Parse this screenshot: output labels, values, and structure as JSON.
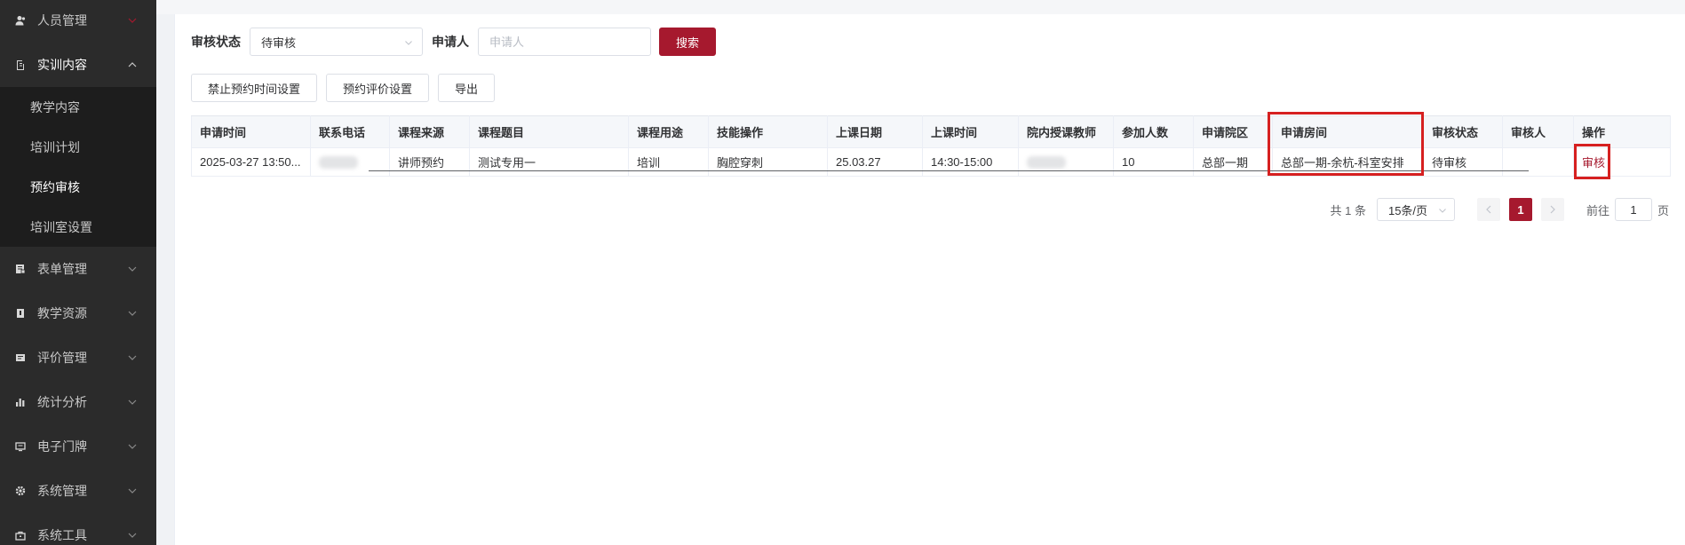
{
  "sidebar": {
    "items": [
      {
        "label": "人员管理",
        "icon": "user-icon"
      },
      {
        "label": "实训内容",
        "icon": "clipboard-icon",
        "expanded": true,
        "children": [
          {
            "label": "教学内容"
          },
          {
            "label": "培训计划"
          },
          {
            "label": "预约审核",
            "active": true
          },
          {
            "label": "培训室设置"
          }
        ]
      },
      {
        "label": "表单管理",
        "icon": "form-icon"
      },
      {
        "label": "教学资源",
        "icon": "book-icon"
      },
      {
        "label": "评价管理",
        "icon": "rating-icon"
      },
      {
        "label": "统计分析",
        "icon": "bar-chart-icon"
      },
      {
        "label": "电子门牌",
        "icon": "monitor-icon"
      },
      {
        "label": "系统管理",
        "icon": "gear-icon"
      },
      {
        "label": "系统工具",
        "icon": "toolbox-icon"
      }
    ]
  },
  "filters": {
    "status_label": "审核状态",
    "status_value": "待审核",
    "applicant_label": "申请人",
    "applicant_placeholder": "申请人",
    "search_label": "搜索"
  },
  "actions": {
    "disable_time": "禁止预约时间设置",
    "eval_setting": "预约评价设置",
    "export": "导出"
  },
  "table": {
    "headers": [
      "申请时间",
      "联系电话",
      "课程来源",
      "课程题目",
      "课程用途",
      "技能操作",
      "上课日期",
      "上课时间",
      "院内授课教师",
      "参加人数",
      "申请院区",
      "申请房间",
      "审核状态",
      "审核人",
      "操作"
    ],
    "rows": [
      {
        "apply_time": "2025-03-27 13:50...",
        "source": "讲师预约",
        "title": "测试专用一",
        "purpose": "培训",
        "skill": "胸腔穿刺",
        "date": "25.03.27",
        "time": "14:30-15:00",
        "count": "10",
        "campus": "总部一期",
        "room": "总部一期-余杭-科室安排",
        "status": "待审核",
        "reviewer": "",
        "op": "审核"
      }
    ]
  },
  "pagination": {
    "total": "共 1 条",
    "page_size": "15条/页",
    "current": "1",
    "goto": "前往",
    "goto_value": "1",
    "page_unit": "页"
  },
  "colors": {
    "accent": "#a6192e",
    "sidebar_bg": "#2b2b2b",
    "submenu_bg": "#1d1d1d",
    "highlight": "#d62020"
  }
}
